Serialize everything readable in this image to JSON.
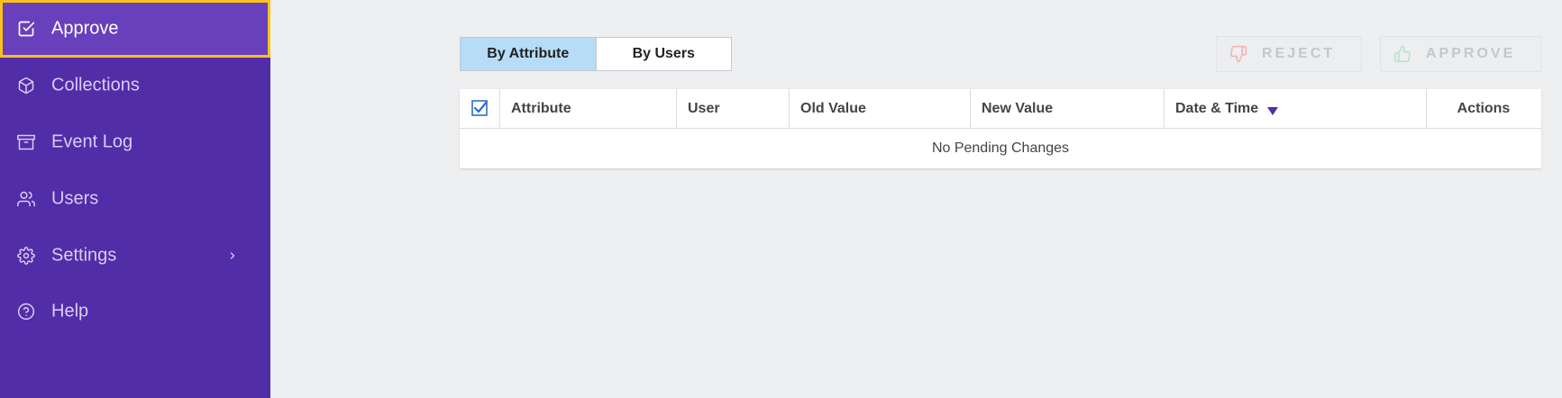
{
  "sidebar": {
    "items": [
      {
        "label": "Approve",
        "icon": "check-square-icon"
      },
      {
        "label": "Collections",
        "icon": "box-icon"
      },
      {
        "label": "Event Log",
        "icon": "archive-icon"
      },
      {
        "label": "Users",
        "icon": "users-icon"
      },
      {
        "label": "Settings",
        "icon": "gear-icon"
      },
      {
        "label": "Help",
        "icon": "help-circle-icon"
      }
    ],
    "active": "Approve",
    "colors": {
      "background": "#512da8",
      "active_background": "#6840bc",
      "active_border": "#fbc01c"
    }
  },
  "toolbar": {
    "tabs": [
      {
        "label": "By Attribute",
        "selected": true
      },
      {
        "label": "By Users",
        "selected": false
      }
    ],
    "reject_label": "REJECT",
    "approve_label": "APPROVE"
  },
  "table": {
    "columns": [
      "Attribute",
      "User",
      "Old Value",
      "New Value",
      "Date & Time",
      "Actions"
    ],
    "sort_column": "Date & Time",
    "sort_direction": "descending",
    "empty_message": "No Pending Changes",
    "select_all_checked": true
  }
}
